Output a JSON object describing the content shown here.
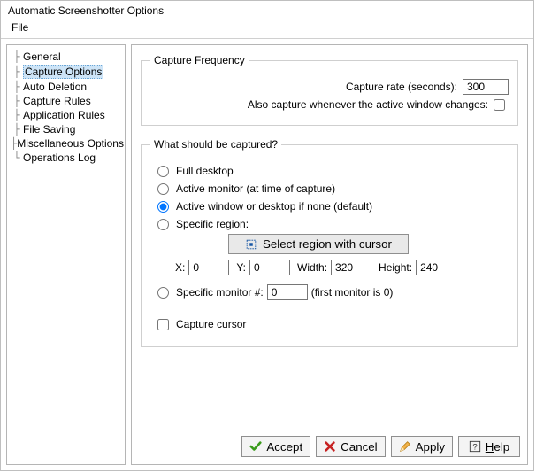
{
  "window": {
    "title": "Automatic Screenshotter Options"
  },
  "menubar": {
    "file": "File"
  },
  "nav": {
    "items": [
      "General",
      "Capture Options",
      "Auto Deletion",
      "Capture Rules",
      "Application Rules",
      "File Saving",
      "Miscellaneous Options",
      "Operations Log"
    ],
    "selected_index": 1
  },
  "freq": {
    "legend": "Capture Frequency",
    "rate_label": "Capture rate (seconds):",
    "rate_value": "300",
    "window_change_label": "Also capture whenever the active window changes:"
  },
  "what": {
    "legend": "What should be captured?",
    "options": {
      "full_desktop": "Full desktop",
      "active_monitor": "Active monitor (at time of capture)",
      "active_window": "Active window or desktop if none (default)",
      "specific_region": "Specific region:",
      "specific_monitor": "Specific monitor #:"
    },
    "selected": "active_window",
    "region_button": "Select region with cursor",
    "region": {
      "x_label": "X:",
      "x": "0",
      "y_label": "Y:",
      "y": "0",
      "w_label": "Width:",
      "w": "320",
      "h_label": "Height:",
      "h": "240"
    },
    "specific_monitor_value": "0",
    "specific_monitor_hint": "(first monitor is 0)",
    "capture_cursor": "Capture cursor"
  },
  "buttons": {
    "accept": "Accept",
    "cancel": "Cancel",
    "apply": "Apply",
    "help": "elp",
    "help_letter": "H"
  }
}
